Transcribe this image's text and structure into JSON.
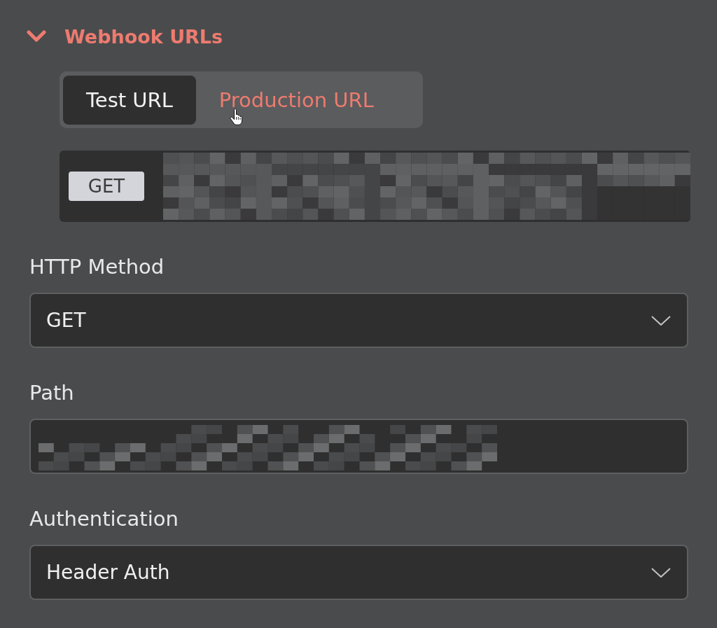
{
  "section": {
    "title": "Webhook URLs",
    "expanded": true
  },
  "url_tabs": [
    {
      "label": "Test URL",
      "selected": true,
      "hovered": false
    },
    {
      "label": "Production URL",
      "selected": false,
      "hovered": true
    }
  ],
  "url_display": {
    "method_badge": "GET",
    "redacted": true
  },
  "fields": [
    {
      "kind": "select",
      "label": "HTTP Method",
      "value": "GET"
    },
    {
      "kind": "input",
      "label": "Path",
      "redacted": true
    },
    {
      "kind": "select",
      "label": "Authentication",
      "value": "Header Auth"
    }
  ]
}
